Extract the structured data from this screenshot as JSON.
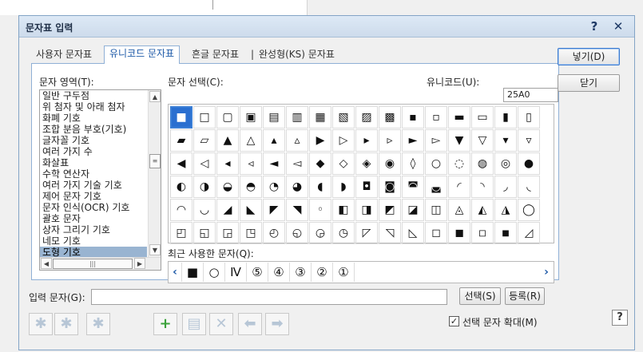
{
  "dialog": {
    "title": "문자표 입력",
    "help_glyph": "?",
    "close_glyph": "✕"
  },
  "tabs": [
    {
      "label": "사용자 문자표",
      "active": false
    },
    {
      "label": "유니코드 문자표",
      "active": true
    },
    {
      "label": "흔글 문자표",
      "active": false
    },
    {
      "label": "완성형(KS) 문자표",
      "active": false
    }
  ],
  "tab_separator": "|",
  "left": {
    "label": "문자 영역(T):",
    "items": [
      "일반 구두점",
      "위 첨자 및 아래 첨자",
      "화폐 기호",
      "조합 분음 부호(기호)",
      "글자꼴 기호",
      "여러 가지 수",
      "화살표",
      "수학 연산자",
      "여러 가지 기술 기호",
      "제어 문자 기호",
      "문자 인식(OCR) 기호",
      "괄호 문자",
      "상자 그리기 기호",
      "네모 기호",
      "도형 기호"
    ],
    "selected_index": 14,
    "scroll_up": "▲",
    "scroll_down": "▼",
    "scroll_left": "◀",
    "scroll_right": "▶",
    "thumb_grip": "≡",
    "hthumb_grip": "|||"
  },
  "grid": {
    "label": "문자 선택(C):",
    "unicode_label": "유니코드(U):",
    "unicode_value": "25A0",
    "selected_index": 0,
    "chars": [
      "■",
      "□",
      "▢",
      "▣",
      "▤",
      "▥",
      "▦",
      "▧",
      "▨",
      "▩",
      "▪",
      "▫",
      "▬",
      "▭",
      "▮",
      "▯",
      "▰",
      "▱",
      "▲",
      "△",
      "▴",
      "▵",
      "▶",
      "▷",
      "▸",
      "▹",
      "►",
      "▻",
      "▼",
      "▽",
      "▾",
      "▿",
      "◀",
      "◁",
      "◂",
      "◃",
      "◄",
      "◅",
      "◆",
      "◇",
      "◈",
      "◉",
      "◊",
      "○",
      "◌",
      "◍",
      "◎",
      "●",
      "◐",
      "◑",
      "◒",
      "◓",
      "◔",
      "◕",
      "◖",
      "◗",
      "◘",
      "◙",
      "◚",
      "◛",
      "◜",
      "◝",
      "◞",
      "◟",
      "◠",
      "◡",
      "◢",
      "◣",
      "◤",
      "◥",
      "◦",
      "◧",
      "◨",
      "◩",
      "◪",
      "◫",
      "◬",
      "◭",
      "◮",
      "◯",
      "◰",
      "◱",
      "◲",
      "◳",
      "◴",
      "◵",
      "◶",
      "◷",
      "◸",
      "◹",
      "◺",
      "◻",
      "◼",
      "◽",
      "◾",
      "◿"
    ]
  },
  "recent": {
    "label": "최근 사용한 문자(Q):",
    "left_arrow": "‹",
    "right_arrow": "›",
    "chars": [
      "■",
      "○",
      "Ⅳ",
      "⑤",
      "④",
      "③",
      "②",
      "①"
    ]
  },
  "buttons": {
    "insert": "넣기(D)",
    "close": "닫기",
    "select": "선택(S)",
    "register": "등록(R)"
  },
  "input": {
    "label": "입력 문자(G):",
    "value": ""
  },
  "toolbar": [
    {
      "name": "add-multiple-icon",
      "glyph": "✱",
      "enabled": false
    },
    {
      "name": "edit-multiple-icon",
      "glyph": "✱",
      "enabled": false
    },
    {
      "name": "delete-multiple-icon",
      "glyph": "✱",
      "enabled": false
    },
    {
      "name": "add-icon",
      "glyph": "+",
      "enabled": true
    },
    {
      "name": "insert-row-icon",
      "glyph": "▤",
      "enabled": false
    },
    {
      "name": "delete-icon",
      "glyph": "✕",
      "enabled": false
    },
    {
      "name": "arrow-left-icon",
      "glyph": "⬅",
      "enabled": false
    },
    {
      "name": "arrow-right-icon",
      "glyph": "➡",
      "enabled": false
    }
  ],
  "enlarge": {
    "label": "선택 문자 확대(M)",
    "checked": true,
    "check_glyph": "✓"
  },
  "help_small": "?"
}
